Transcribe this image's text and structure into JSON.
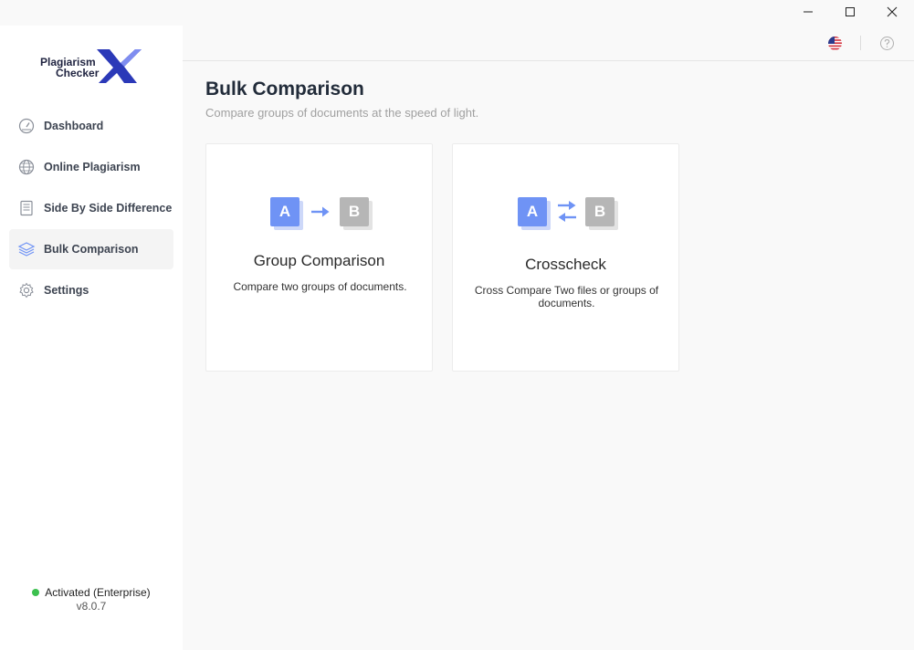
{
  "window": {
    "controls": {
      "minimize": "minimize-icon",
      "maximize": "maximize-icon",
      "close": "close-icon"
    }
  },
  "logo": {
    "line1": "Plagiarism",
    "line2": "Checker",
    "mark": "X",
    "color": "#2b39b8"
  },
  "sidebar": {
    "items": [
      {
        "label": "Dashboard",
        "icon": "gauge-icon",
        "active": false
      },
      {
        "label": "Online Plagiarism",
        "icon": "globe-icon",
        "active": false
      },
      {
        "label": "Side By Side Difference",
        "icon": "document-icon",
        "active": false
      },
      {
        "label": "Bulk Comparison",
        "icon": "layers-icon",
        "active": true
      },
      {
        "label": "Settings",
        "icon": "gear-icon",
        "active": false
      }
    ]
  },
  "status": {
    "text": "Activated (Enterprise)",
    "version": "v8.0.7",
    "color": "#3cc04f"
  },
  "topbar": {
    "language_icon": "us-flag-icon",
    "help_icon": "help-icon"
  },
  "page": {
    "title": "Bulk Comparison",
    "subtitle": "Compare groups of documents at the speed of light."
  },
  "cards": [
    {
      "title": "Group Comparison",
      "description": "Compare two groups of documents.",
      "box_a": "A",
      "box_b": "B"
    },
    {
      "title": "Crosscheck",
      "description": "Cross Compare Two files or groups of documents.",
      "box_a": "A",
      "box_b": "B"
    }
  ],
  "colors": {
    "accent": "#6f93f5",
    "muted_box": "#b6b6b6"
  }
}
